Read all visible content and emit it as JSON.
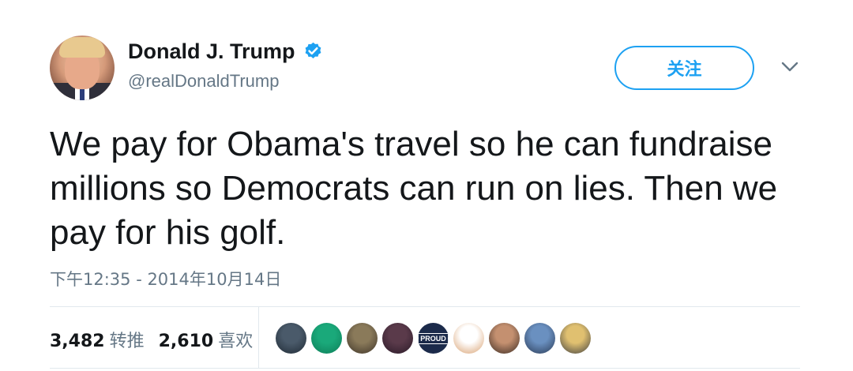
{
  "user": {
    "name": "Donald J. Trump",
    "handle": "@realDonaldTrump",
    "verified": true
  },
  "follow_label": "关注",
  "tweet": {
    "text": "We pay for Obama's travel so he can fundraise millions so Democrats can run on lies. Then we pay for his golf.",
    "timestamp": "下午12:35 - 2014年10月14日"
  },
  "stats": {
    "retweets": "3,482",
    "retweets_label": "转推",
    "likes": "2,610",
    "likes_label": "喜欢"
  },
  "liker_avatars": [
    {
      "colors": [
        "#4a5a6a",
        "#1f2a35"
      ]
    },
    {
      "colors": [
        "#1aa97a",
        "#0e7d58"
      ]
    },
    {
      "colors": [
        "#8a7a5a",
        "#3e3428"
      ]
    },
    {
      "colors": [
        "#5a3a4a",
        "#2a1a28"
      ]
    },
    {
      "label": "PROUD",
      "colors": [
        "#1b2a4a",
        "#1b2a4a"
      ]
    },
    {
      "colors": [
        "#ffffff",
        "#d8a070"
      ]
    },
    {
      "colors": [
        "#c49070",
        "#3a2a22"
      ]
    },
    {
      "colors": [
        "#6a90c0",
        "#2a3a55"
      ]
    },
    {
      "colors": [
        "#e0c070",
        "#404040"
      ]
    }
  ],
  "colors": {
    "accent": "#1da1f2",
    "text": "#14171a",
    "muted": "#657786",
    "divider": "#e1e8ed"
  }
}
